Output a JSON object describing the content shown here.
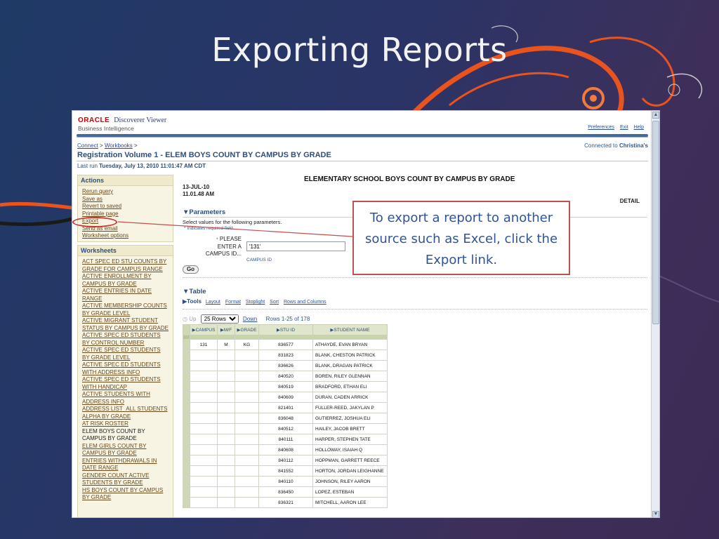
{
  "slide": {
    "title": "Exporting Reports",
    "callout_text": "To export a report to another source such as Excel, click the Export link.",
    "accent_color": "#e8531e"
  },
  "app": {
    "brand": "ORACLE",
    "product": "Discoverer Viewer",
    "suite": "Business Intelligence",
    "top_links": [
      "Preferences",
      "Exit",
      "Help"
    ],
    "breadcrumb": [
      "Connect",
      "Workbooks"
    ],
    "breadcrumb_sep": ">",
    "connected_prefix": "Connected to",
    "connected_name": "Christina's",
    "page_title": "Registration Volume 1 - ELEM BOYS COUNT BY CAMPUS BY GRADE",
    "last_run_label": "Last run",
    "last_run_value": "Tuesday, July 13, 2010 11:01:47 AM CDT"
  },
  "actions": {
    "header": "Actions",
    "items": [
      "Rerun query",
      "Save as",
      "Revert to saved",
      "Printable page",
      "Export",
      "Send as email",
      "Worksheet options"
    ]
  },
  "worksheets": {
    "header": "Worksheets",
    "items": [
      {
        "label": "ACT SPEC ED STU COUNTS BY GRADE FOR CAMPUS RANGE",
        "link": true
      },
      {
        "label": "ACTIVE ENROLLMENT BY CAMPUS BY GRADE",
        "link": true
      },
      {
        "label": "ACTIVE ENTRIES IN DATE RANGE",
        "link": true
      },
      {
        "label": "ACTIVE MEMBERSHIP COUNTS BY GRADE LEVEL",
        "link": true
      },
      {
        "label": "ACTIVE MIGRANT STUDENT STATUS BY CAMPUS BY GRADE",
        "link": true
      },
      {
        "label": "ACTIVE SPEC ED STUDENTS BY CONTROL NUMBER",
        "link": true
      },
      {
        "label": "ACTIVE SPEC ED STUDENTS BY GRADE LEVEL",
        "link": true
      },
      {
        "label": "ACTIVE SPEC ED STUDENTS WITH ADDRESS INFO",
        "link": true
      },
      {
        "label": "ACTIVE SPEC ED STUDENTS WITH HANDICAP",
        "link": true
      },
      {
        "label": "ACTIVE STUDENTS WITH ADDRESS INFO",
        "link": true
      },
      {
        "label": "ADDRESS LIST_ALL STUDENTS ALPHA BY GRADE",
        "link": true
      },
      {
        "label": "AT RISK ROSTER",
        "link": true
      },
      {
        "label": "ELEM BOYS COUNT BY CAMPUS BY GRADE",
        "link": false
      },
      {
        "label": "ELEM GIRLS COUNT BY CAMPUS BY GRADE",
        "link": true
      },
      {
        "label": "ENTRIES WITHDRAWALS IN DATE RANGE",
        "link": true
      },
      {
        "label": "GENDER COUNT ACTIVE STUDENTS BY GRADE",
        "link": true
      },
      {
        "label": "HS BOYS COUNT BY CAMPUS BY GRADE",
        "link": true
      }
    ]
  },
  "report": {
    "heading": "ELEMENTARY SCHOOL BOYS COUNT BY CAMPUS BY GRADE",
    "date": "13-JUL-10",
    "time": "11.01.48 AM",
    "detail": "DETAIL"
  },
  "parameters": {
    "header": "Parameters",
    "instruction": "Select values for the following parameters.",
    "required_note": "Indicates required field",
    "required_mark": "*",
    "label_lines": [
      "PLEASE",
      "ENTER A",
      "CAMPUS ID..."
    ],
    "value": "'131'",
    "hint": "CAMPUS ID",
    "go_label": "Go"
  },
  "table": {
    "header": "Table",
    "tools_label": "Tools",
    "tools": [
      "Layout",
      "Format",
      "Stoplight",
      "Sort",
      "Rows and Columns"
    ],
    "up_label": "Up",
    "rows_option": "25 Rows",
    "down_label": "Down",
    "range_label": "Rows 1-25 of 178",
    "columns": [
      "CAMPUS",
      "M/F",
      "GRADE",
      "STU ID",
      "STUDENT NAME"
    ],
    "rows": [
      [
        "131",
        "M",
        "KG",
        "836577",
        "ATHAYDE, EVAN BRYAN"
      ],
      [
        "",
        "",
        "",
        "831823",
        "BLANK, CHESTON PATRICK"
      ],
      [
        "",
        "",
        "",
        "836626",
        "BLANK, DRAGAN PATRICK"
      ],
      [
        "",
        "",
        "",
        "840520",
        "BOREN, RILEY GLENNAN"
      ],
      [
        "",
        "",
        "",
        "840519",
        "BRADFORD, ETHAN ELI"
      ],
      [
        "",
        "",
        "",
        "840609",
        "DURAN, CADEN ARRICK"
      ],
      [
        "",
        "",
        "",
        "821401",
        "FULLER-REED, JAKYLAN P"
      ],
      [
        "",
        "",
        "",
        "836048",
        "GUTIERREZ, JOSHUA ELI"
      ],
      [
        "",
        "",
        "",
        "840512",
        "HAILEY, JACOB BRETT"
      ],
      [
        "",
        "",
        "",
        "840111",
        "HARPER, STEPHEN TATE"
      ],
      [
        "",
        "",
        "",
        "840608",
        "HOLLOWAY, ISAIAH Q"
      ],
      [
        "",
        "",
        "",
        "840112",
        "HOPPMAN, GARRETT REECE"
      ],
      [
        "",
        "",
        "",
        "841552",
        "HORTON, JORDAN LEIGHANNE"
      ],
      [
        "",
        "",
        "",
        "840110",
        "JOHNSON, RILEY AARON"
      ],
      [
        "",
        "",
        "",
        "836450",
        "LOPEZ, ESTEBAN"
      ],
      [
        "",
        "",
        "",
        "836321",
        "MITCHELL, AARON LEE"
      ]
    ]
  }
}
